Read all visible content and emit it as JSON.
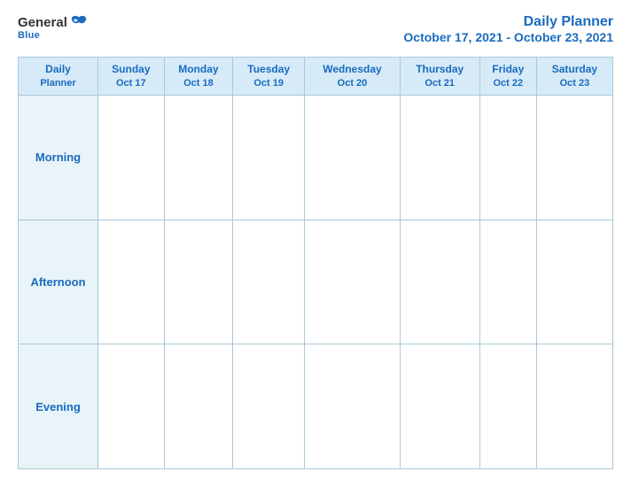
{
  "logo": {
    "general": "General",
    "blue": "Blue",
    "tagline": "Blue"
  },
  "title": {
    "main": "Daily Planner",
    "sub": "October 17, 2021 - October 23, 2021"
  },
  "header_row": {
    "label": "Daily\nPlanner",
    "label_line1": "Daily",
    "label_line2": "Planner",
    "days": [
      {
        "name": "Sunday",
        "date": "Oct 17"
      },
      {
        "name": "Monday",
        "date": "Oct 18"
      },
      {
        "name": "Tuesday",
        "date": "Oct 19"
      },
      {
        "name": "Wednesday",
        "date": "Oct 20"
      },
      {
        "name": "Thursday",
        "date": "Oct 21"
      },
      {
        "name": "Friday",
        "date": "Oct 22"
      },
      {
        "name": "Saturday",
        "date": "Oct 23"
      }
    ]
  },
  "rows": [
    {
      "label": "Morning"
    },
    {
      "label": "Afternoon"
    },
    {
      "label": "Evening"
    }
  ]
}
